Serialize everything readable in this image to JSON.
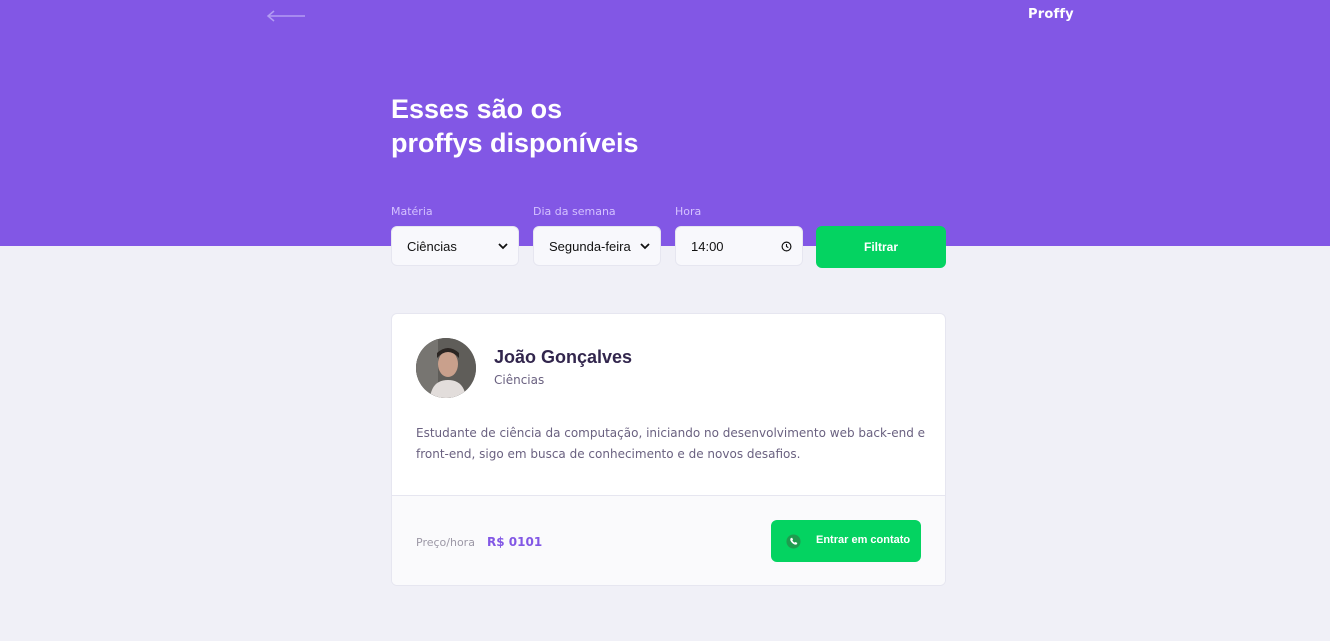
{
  "header": {
    "logo": "Proffy",
    "title_line1": "Esses são os",
    "title_line2": "proffys disponíveis"
  },
  "filters": {
    "subject": {
      "label": "Matéria",
      "value": "Ciências"
    },
    "weekday": {
      "label": "Dia da semana",
      "value": "Segunda-feira"
    },
    "time": {
      "label": "Hora",
      "value": "14:00"
    },
    "submit_label": "Filtrar"
  },
  "teacher": {
    "name": "João Gonçalves",
    "subject": "Ciências",
    "bio": "Estudante de ciência da computação, iniciando no desenvolvimento web back-end e front-end, sigo em busca de conhecimento e de novos desafios.",
    "price_label": "Preço/hora",
    "price_value": "R$ 0101",
    "contact_label": "Entrar em contato"
  },
  "colors": {
    "primary": "#8257e5",
    "secondary": "#04d361",
    "background": "#f0f0f7"
  },
  "icons": {
    "back": "arrow-left-icon",
    "dropdown": "chevron-down-icon",
    "clock": "clock-icon",
    "whatsapp": "whatsapp-icon"
  }
}
